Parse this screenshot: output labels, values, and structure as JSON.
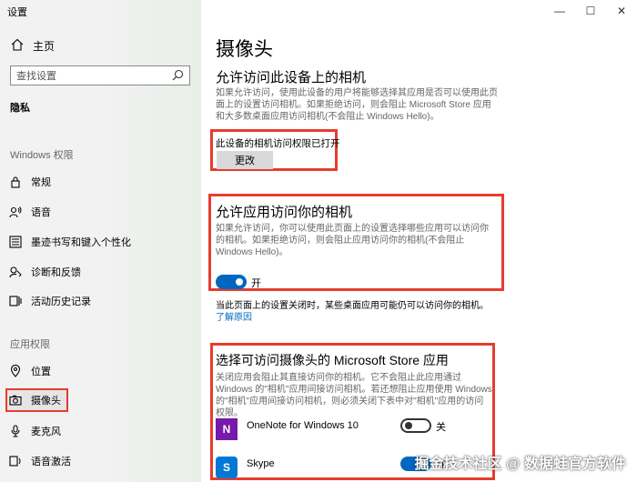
{
  "window": {
    "title": "设置",
    "minimize": "—",
    "maximize": "☐",
    "close": "✕"
  },
  "sidebar": {
    "home_label": "主页",
    "search_placeholder": "查找设置",
    "section": "隐私",
    "group_windows": "Windows 权限",
    "windows_items": [
      {
        "label": "常规",
        "icon": "lock-icon"
      },
      {
        "label": "语音",
        "icon": "speech-icon"
      },
      {
        "label": "墨迹书写和键入个性化",
        "icon": "keyboard-icon"
      },
      {
        "label": "诊断和反馈",
        "icon": "feedback-icon"
      },
      {
        "label": "活动历史记录",
        "icon": "history-icon"
      }
    ],
    "group_app": "应用权限",
    "app_items": [
      {
        "label": "位置",
        "icon": "location-icon"
      },
      {
        "label": "摄像头",
        "icon": "camera-icon"
      },
      {
        "label": "麦克风",
        "icon": "microphone-icon"
      },
      {
        "label": "语音激活",
        "icon": "voice-icon"
      }
    ]
  },
  "main": {
    "title": "摄像头",
    "section1": {
      "heading": "允许访问此设备上的相机",
      "desc": "如果允许访问，使用此设备的用户将能够选择其应用是否可以使用此页面上的设置访问相机。如果拒绝访问，则会阻止 Microsoft Store 应用和大多数桌面应用访问相机(不会阻止 Windows Hello)。",
      "status": "此设备的相机访问权限已打开",
      "button": "更改"
    },
    "section2": {
      "heading": "允许应用访问你的相机",
      "desc": "如果允许访问，你可以使用此页面上的设置选择哪些应用可以访问你的相机。如果拒绝访问，则会阻止应用访问你的相机(不会阻止 Windows Hello)。",
      "toggle_state": "开",
      "note": "当此页面上的设置关闭时，某些桌面应用可能仍可以访问你的相机。",
      "note_link": "了解原因"
    },
    "section3": {
      "heading": "选择可访问摄像头的 Microsoft Store 应用",
      "desc": "关闭应用会阻止其直接访问你的相机。它不会阻止此应用通过 Windows 的\"相机\"应用间接访问相机。若还想阻止应用使用 Windows 的\"相机\"应用间接访问相机，则必须关闭下表中对\"相机\"应用的访问权限。",
      "apps": [
        {
          "name": "OneNote for Windows 10",
          "state": "关",
          "icon_text": "N",
          "color": "#7719aa"
        },
        {
          "name": "Skype",
          "state": "开",
          "icon_text": "S",
          "color": "#0078d4"
        }
      ]
    }
  },
  "watermark": "掘金技术社区 @ 数据蛙官方软件"
}
